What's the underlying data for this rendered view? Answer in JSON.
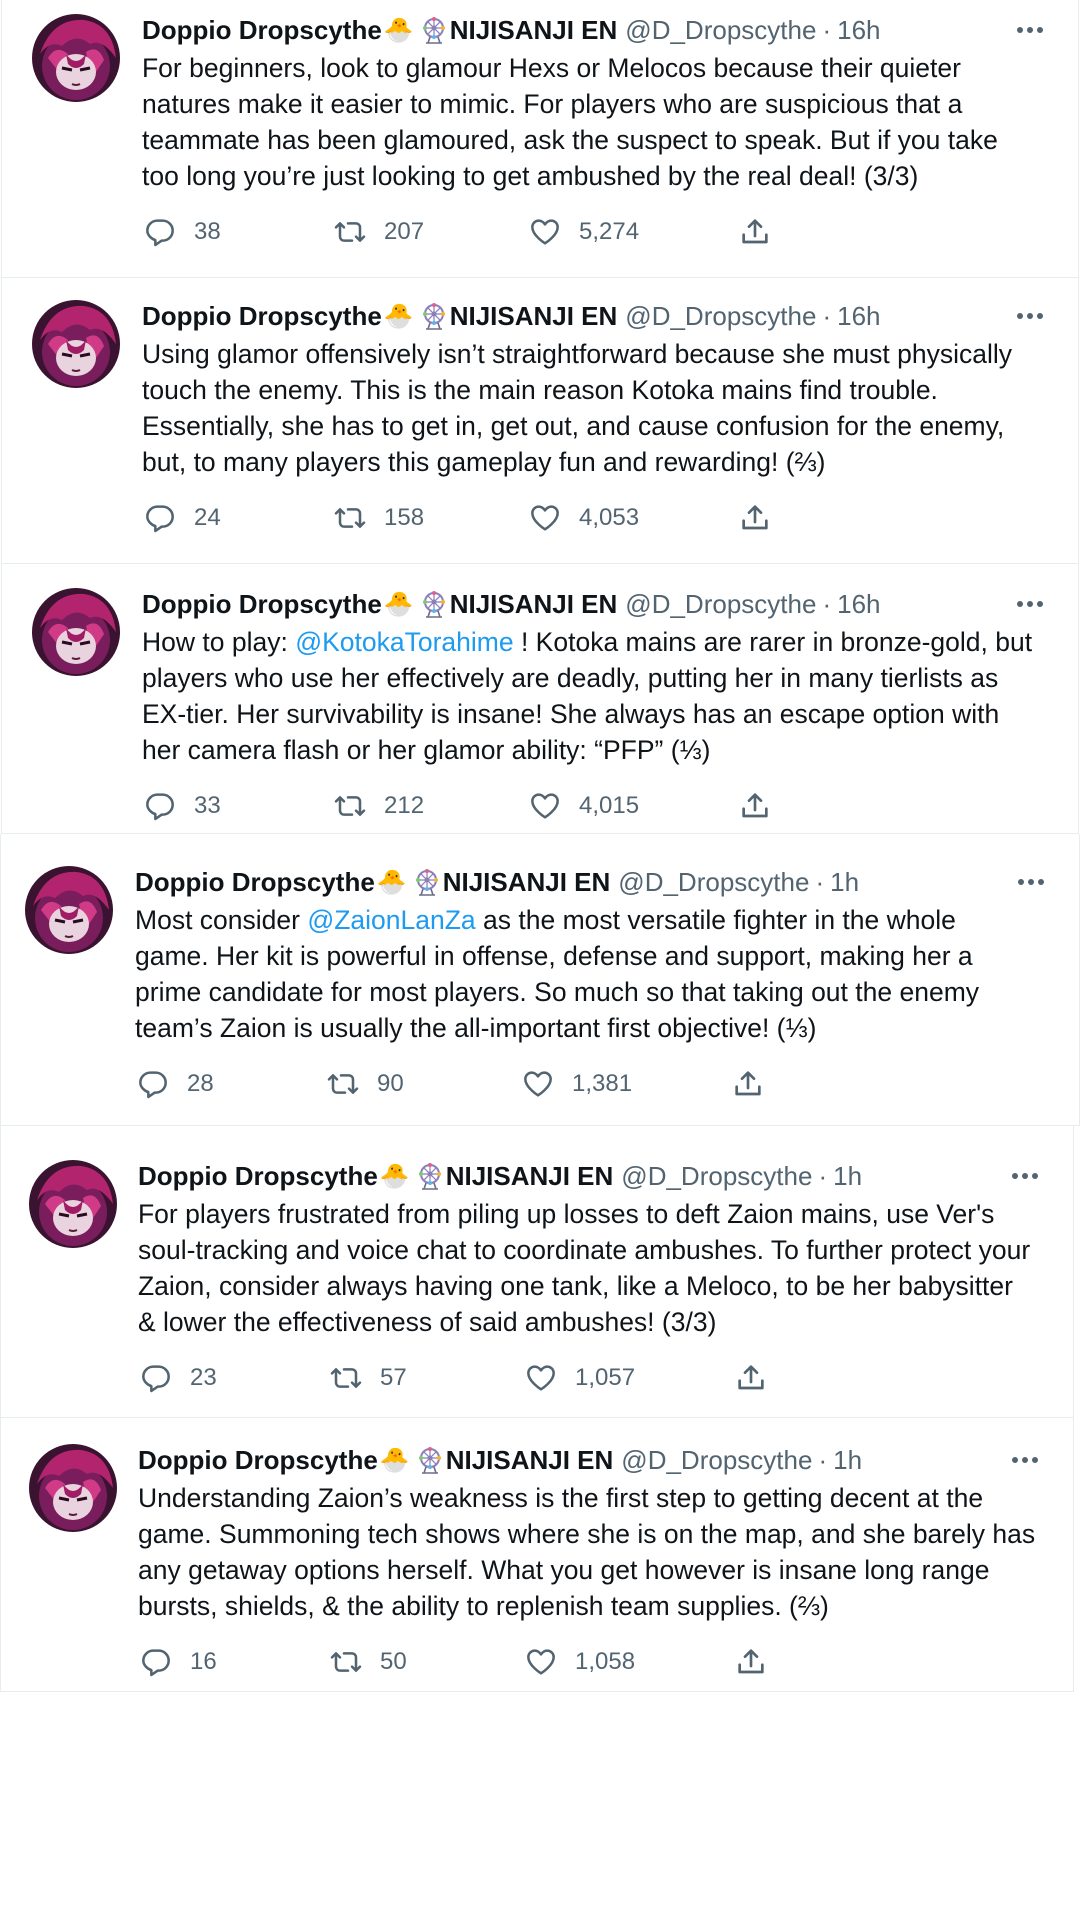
{
  "colors": {
    "text": "#0f1419",
    "secondary": "#536471",
    "link": "#1d9bf0",
    "divider": "#e6ecf0"
  },
  "tweets": [
    {
      "name": "Doppio Dropscythe",
      "emoji": "🐣",
      "org": "NIJISANJI EN",
      "handle": "@D_Dropscythe",
      "dot": "·",
      "time": "16h",
      "text_before": "For beginners, look to glamour Hexs or Melocos because their quieter natures make it easier to mimic. For players who are suspicious that a teammate has been glamoured, ask the suspect to speak. But if you take too long you’re just looking to get ambushed by the real deal! (3/3)",
      "mention": "",
      "text_after": "",
      "replies": "38",
      "retweets": "207",
      "likes": "5,274"
    },
    {
      "name": "Doppio Dropscythe",
      "emoji": "🐣",
      "org": "NIJISANJI EN",
      "handle": "@D_Dropscythe",
      "dot": "·",
      "time": "16h",
      "text_before": "Using glamor offensively isn’t straightforward because she must physically touch the enemy. This is the main reason Kotoka mains find trouble. Essentially, she has to get in, get out, and cause confusion for the enemy, but, to many players this gameplay fun and rewarding! (⅔)",
      "mention": "",
      "text_after": "",
      "replies": "24",
      "retweets": "158",
      "likes": "4,053"
    },
    {
      "name": "Doppio Dropscythe",
      "emoji": "🐣",
      "org": "NIJISANJI EN",
      "handle": "@D_Dropscythe",
      "dot": "·",
      "time": "16h",
      "text_before": "How to play: ",
      "mention": "@KotokaTorahime",
      "text_after": " ! Kotoka mains are rarer in bronze-gold, but players who use her effectively are deadly, putting her in many tierlists as EX-tier. Her survivability is insane! She always has an escape option with her camera flash or her glamor ability: “PFP” (⅓)",
      "replies": "33",
      "retweets": "212",
      "likes": "4,015"
    },
    {
      "name": "Doppio Dropscythe",
      "emoji": "🐣",
      "org": "NIJISANJI EN",
      "handle": "@D_Dropscythe",
      "dot": "·",
      "time": "1h",
      "text_before": "Most consider ",
      "mention": "@ZaionLanZa",
      "text_after": " as the most versatile fighter in the whole game. Her kit is powerful in offense, defense and support, making her a prime candidate for most players. So much so that taking out the enemy team’s Zaion is usually the all-important first objective! (⅓)",
      "replies": "28",
      "retweets": "90",
      "likes": "1,381"
    },
    {
      "name": "Doppio Dropscythe",
      "emoji": "🐣",
      "org": "NIJISANJI EN",
      "handle": "@D_Dropscythe",
      "dot": "·",
      "time": "1h",
      "text_before": "For players frustrated from piling up losses to deft Zaion mains, use Ver's soul-tracking and voice chat to coordinate ambushes. To further protect your Zaion, consider always having one tank, like a Meloco, to be her babysitter & lower the effectiveness of said ambushes! (3/3)",
      "mention": "",
      "text_after": "",
      "replies": "23",
      "retweets": "57",
      "likes": "1,057"
    },
    {
      "name": "Doppio Dropscythe",
      "emoji": "🐣",
      "org": "NIJISANJI EN",
      "handle": "@D_Dropscythe",
      "dot": "·",
      "time": "1h",
      "text_before": "Understanding Zaion’s weakness is the first step to getting decent at the game. Summoning tech shows where she is on the map, and she barely has any getaway options herself. What you get however is insane long range bursts, shields, & the ability to replenish team supplies. (⅔)",
      "mention": "",
      "text_after": "",
      "replies": "16",
      "retweets": "50",
      "likes": "1,058"
    }
  ]
}
